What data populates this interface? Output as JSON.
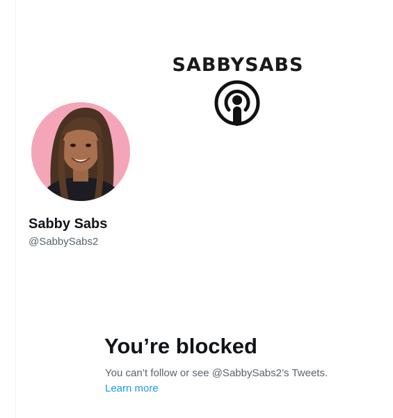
{
  "banner": {
    "wordmark": "SABBYSABS",
    "icon": "podcast-icon"
  },
  "profile": {
    "display_name": "Sabby Sabs",
    "handle": "@SabbySabs2",
    "avatar_bg_color": "#f4a6b8"
  },
  "blocked": {
    "title": "You’re blocked",
    "description": "You can’t follow or see @SabbySabs2’s Tweets.",
    "learn_more_label": "Learn more"
  },
  "colors": {
    "primary_text": "#0f1419",
    "secondary_text": "#536471",
    "link": "#1d9bf0"
  }
}
